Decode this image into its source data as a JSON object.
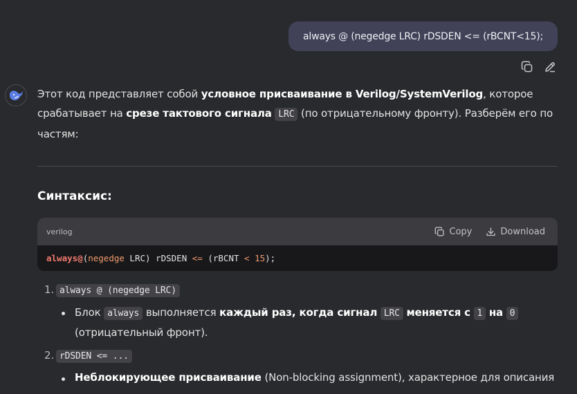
{
  "user_message": "always @ (negedge LRC) rDSDEN <= (rBCNT<15);",
  "icons": {
    "copy": "copy-icon",
    "edit": "edit-icon",
    "avatar": "whale-logo-icon",
    "download": "download-icon"
  },
  "answer": {
    "intro": {
      "t1": "Этот код представляет собой ",
      "b1": "условное присваивание в Verilog/SystemVerilog",
      "t2": ", которое срабатывает на ",
      "b2": "срезе тактового сигнала",
      "t3": " ",
      "c1": "LRC",
      "t4": " (по отрицательному фронту). Разберём его по частям:"
    },
    "syntax_heading": "Синтаксис:",
    "code_block": {
      "language": "verilog",
      "copy_label": "Copy",
      "download_label": "Download",
      "tokens": [
        "always",
        "@",
        "(",
        "negedge",
        " LRC) rDSDEN ",
        "<=",
        " (rBCNT ",
        "<",
        " ",
        "15",
        ");"
      ]
    },
    "list": [
      {
        "number": "1.",
        "code": "always @ (negedge LRC)",
        "bullet": {
          "t1": "Блок ",
          "c1": "always",
          "t2": " выполняется ",
          "b1": "каждый раз, когда сигнал",
          "t3": " ",
          "c2": "LRC",
          "t4": " ",
          "b2": "меняется с",
          "t5": " ",
          "c3": "1",
          "t6": " ",
          "b3": "на",
          "t7": " ",
          "c4": "0",
          "t8": "(отрицательный фронт)."
        }
      },
      {
        "number": "2.",
        "code": "rDSDEN <= ...",
        "bullet": {
          "b1": "Неблокирующее присваивание",
          "t1": " (Non-blocking assignment), характерное для описания"
        }
      }
    ]
  }
}
